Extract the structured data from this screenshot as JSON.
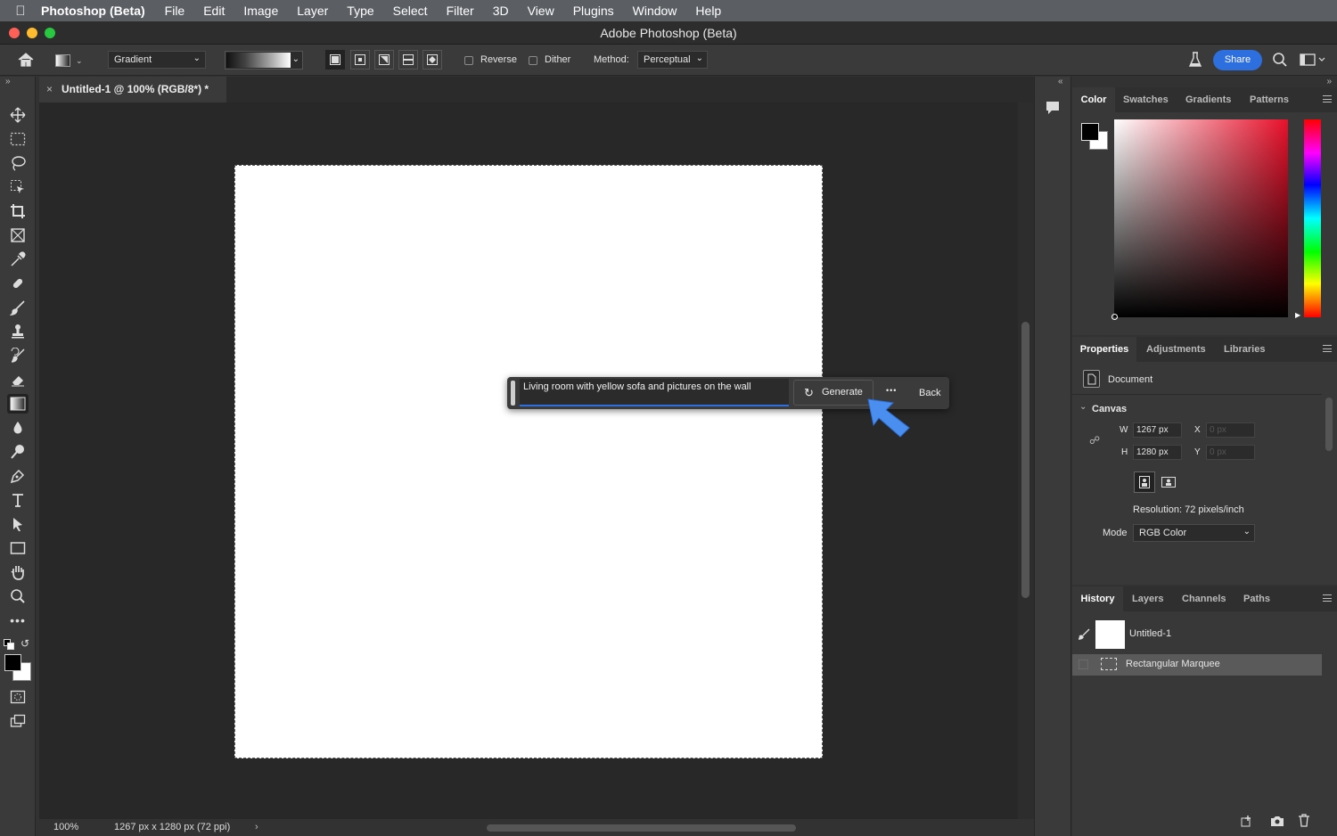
{
  "menubar": {
    "app": "Photoshop (Beta)",
    "items": [
      "File",
      "Edit",
      "Image",
      "Layer",
      "Type",
      "Select",
      "Filter",
      "3D",
      "View",
      "Plugins",
      "Window",
      "Help"
    ]
  },
  "window": {
    "title": "Adobe Photoshop (Beta)"
  },
  "options": {
    "tool_preset": "Gradient",
    "reverse": "Reverse",
    "dither": "Dither",
    "method_label": "Method:",
    "method_value": "Perceptual",
    "share": "Share"
  },
  "document": {
    "tab": "Untitled-1 @ 100% (RGB/8*) *"
  },
  "status": {
    "zoom": "100%",
    "info": "1267 px x 1280 px (72 ppi)"
  },
  "generative": {
    "prompt": "Living room with yellow sofa and pictures on the wall",
    "generate": "Generate",
    "more": "•••",
    "back": "Back"
  },
  "color_panel": {
    "tabs": [
      "Color",
      "Swatches",
      "Gradients",
      "Patterns"
    ],
    "hue_color": "#e8102a"
  },
  "properties_panel": {
    "tabs": [
      "Properties",
      "Adjustments",
      "Libraries"
    ],
    "document_label": "Document",
    "canvas_label": "Canvas",
    "w_label": "W",
    "w_value": "1267 px",
    "h_label": "H",
    "h_value": "1280 px",
    "x_label": "X",
    "x_value": "0 px",
    "y_label": "Y",
    "y_value": "0 px",
    "resolution": "Resolution: 72 pixels/inch",
    "mode_label": "Mode",
    "mode_value": "RGB Color"
  },
  "history_panel": {
    "tabs": [
      "History",
      "Layers",
      "Channels",
      "Paths"
    ],
    "items": [
      "Untitled-1",
      "Rectangular Marquee"
    ]
  },
  "colors": {
    "accent": "#2d6fdf",
    "arrow": "#4a8ff0"
  }
}
